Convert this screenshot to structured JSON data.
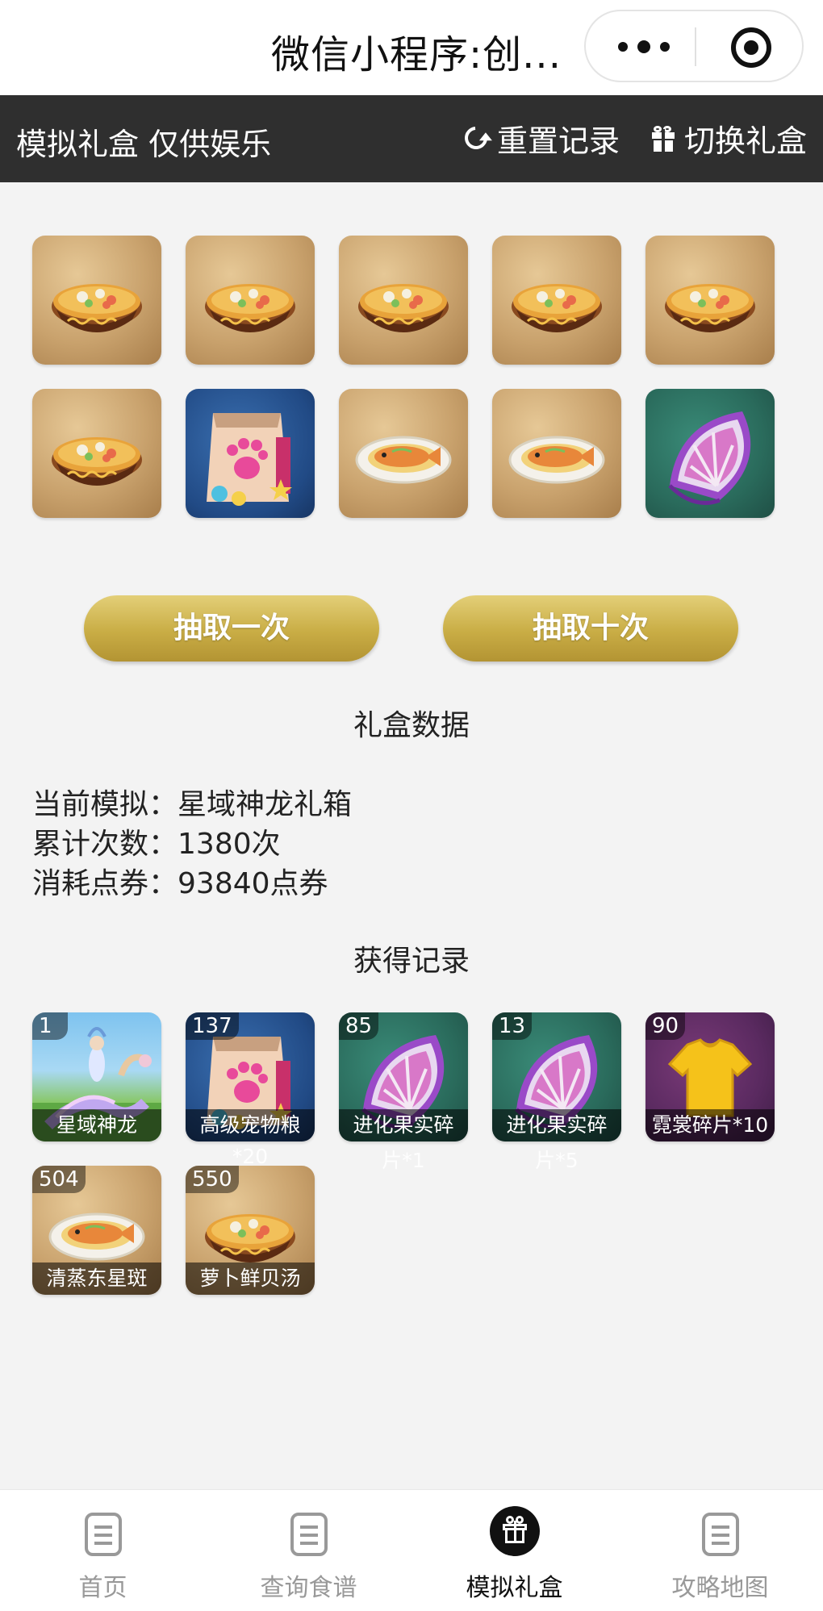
{
  "wx": {
    "title": "微信小程序:创..."
  },
  "toolbar": {
    "title": "模拟礼盒 仅供娱乐",
    "reset_label": "重置记录",
    "switch_label": "切换礼盒"
  },
  "draw_results": [
    {
      "item": "萝卜鲜贝汤",
      "icon": "soup-bowl-icon",
      "bg": "wood"
    },
    {
      "item": "萝卜鲜贝汤",
      "icon": "soup-bowl-icon",
      "bg": "wood"
    },
    {
      "item": "萝卜鲜贝汤",
      "icon": "soup-bowl-icon",
      "bg": "wood"
    },
    {
      "item": "萝卜鲜贝汤",
      "icon": "soup-bowl-icon",
      "bg": "wood"
    },
    {
      "item": "萝卜鲜贝汤",
      "icon": "soup-bowl-icon",
      "bg": "wood"
    },
    {
      "item": "萝卜鲜贝汤",
      "icon": "soup-bowl-icon",
      "bg": "wood"
    },
    {
      "item": "高级宠物粮",
      "icon": "pet-food-bag-icon",
      "bg": "blue"
    },
    {
      "item": "清蒸东星斑",
      "icon": "steamed-fish-icon",
      "bg": "wood"
    },
    {
      "item": "清蒸东星斑",
      "icon": "steamed-fish-icon",
      "bg": "wood"
    },
    {
      "item": "进化果实碎片",
      "icon": "fruit-slice-icon",
      "bg": "teal"
    }
  ],
  "buttons": {
    "draw_one": "抽取一次",
    "draw_ten": "抽取十次"
  },
  "stats": {
    "title": "礼盒数据",
    "current_label": "当前模拟：",
    "current_value": "星域神龙礼箱",
    "count_label": "累计次数：",
    "count_value": "1380次",
    "cost_label": "消耗点券：",
    "cost_value": "93840点券"
  },
  "records": {
    "title": "获得记录",
    "items": [
      {
        "count": "1",
        "name": "星域神龙",
        "extra": "",
        "icon": "dragon-mount-icon",
        "bg": "sky"
      },
      {
        "count": "137",
        "name": "高级宠物粮",
        "extra": "*20",
        "icon": "pet-food-bag-icon",
        "bg": "blue"
      },
      {
        "count": "85",
        "name": "进化果实碎",
        "extra": "片*1",
        "icon": "fruit-slice-icon",
        "bg": "teal"
      },
      {
        "count": "13",
        "name": "进化果实碎",
        "extra": "片*5",
        "icon": "fruit-slice-icon",
        "bg": "teal"
      },
      {
        "count": "90",
        "name": "霓裳碎片*10",
        "extra": "",
        "icon": "shirt-icon",
        "bg": "purple"
      },
      {
        "count": "504",
        "name": "清蒸东星斑",
        "extra": "",
        "icon": "steamed-fish-icon",
        "bg": "wood"
      },
      {
        "count": "550",
        "name": "萝卜鲜贝汤",
        "extra": "",
        "icon": "soup-bowl-icon",
        "bg": "wood"
      }
    ]
  },
  "tabs": [
    {
      "label": "首页",
      "active": false
    },
    {
      "label": "查询食谱",
      "active": false
    },
    {
      "label": "模拟礼盒",
      "active": true
    },
    {
      "label": "攻略地图",
      "active": false
    }
  ],
  "colors": {
    "toolbar_bg": "#2f2f2f",
    "button_gold": "#c9ad45",
    "page_bg": "#f3f3f3"
  }
}
